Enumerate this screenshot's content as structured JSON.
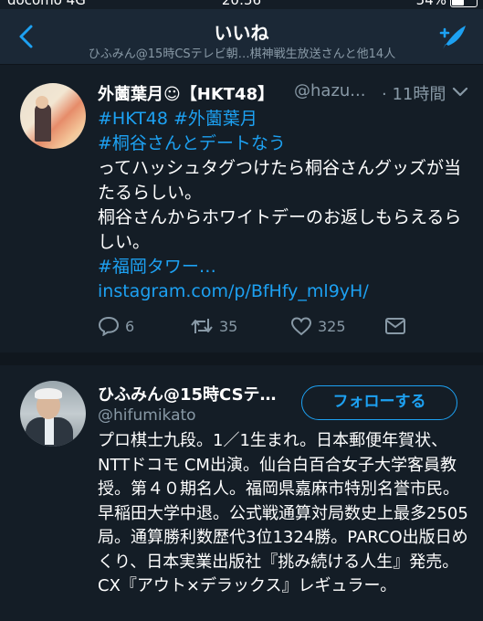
{
  "status_bar": {
    "carrier": "docomo 4G",
    "time": "20:56",
    "battery": "54%"
  },
  "header": {
    "title": "いいね",
    "subtitle": "ひふみん@15時CSテレビ朝…棋神戦生放送さんと他14人"
  },
  "tweet": {
    "name": "外薗葉月☺【HKT48】",
    "handle": "@hazu...",
    "time_ago": "· 11時間",
    "tag_line1": "#HKT48 #外薗葉月",
    "tag_line2": "#桐谷さんとデートなう",
    "text1": "ってハッシュタグつけたら桐谷さんグッズが当たるらしい。",
    "text2": "桐谷さんからホワイトデーのお返しもらえるらしい。",
    "tag_link": "#福岡タワー…",
    "link": "instagram.com/p/BfHfy_ml9yH/",
    "reply_count": "6",
    "retweet_count": "35",
    "like_count": "325"
  },
  "profile": {
    "name": "ひふみん@15時CSテ…",
    "handle": "@hifumikato",
    "follow_label": "フォローする",
    "bio": "プロ棋士九段。1／1生まれ。日本郵便年賀状、NTTドコモ CM出演。仙台白百合女子大学客員教授。第４０期名人。福岡県嘉麻市特別名誉市民。早稲田大学中退。公式戦通算対局数史上最多2505局。通算勝利数歴代3位1324勝。PARCO出版日めくり、日本実業出版社『挑み続ける人生』発売。CX『アウト×デラックス』レギュラー。"
  },
  "icons": {
    "back": "chevron-left-icon",
    "compose": "compose-feather-icon",
    "caret": "chevron-down-icon",
    "reply": "reply-icon",
    "retweet": "retweet-icon",
    "like": "heart-icon",
    "dm": "envelope-icon"
  },
  "colors": {
    "background": "#141d26",
    "header": "#1b2836",
    "accent": "#1da1f2",
    "muted": "#8899a6"
  }
}
